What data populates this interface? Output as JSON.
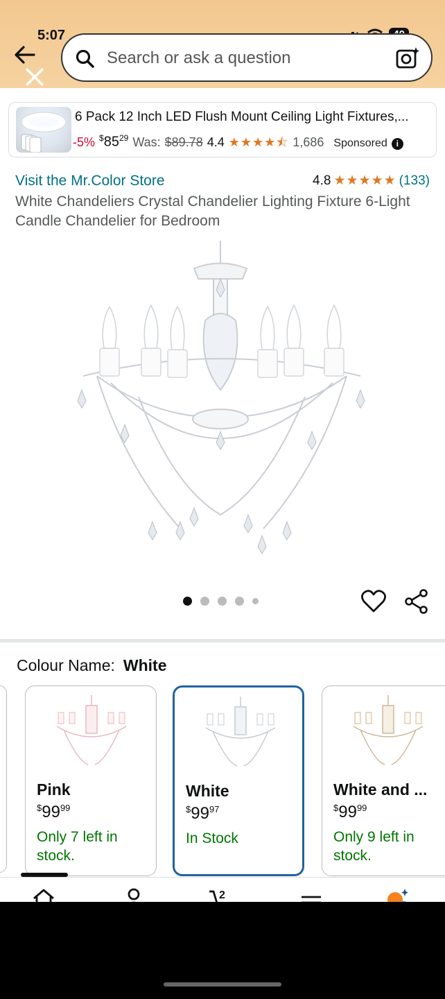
{
  "status": {
    "time": "5:07",
    "battery": "40"
  },
  "search": {
    "placeholder": "Search or ask a question"
  },
  "ad": {
    "title": "6 Pack 12 Inch LED Flush Mount Ceiling Light Fixtures,...",
    "discount": "-5%",
    "price_currency": "$",
    "price_whole": "85",
    "price_fraction": "29",
    "was_label": "Was:",
    "was_price": "$89.78",
    "rating": "4.4",
    "stars": "★★★★⯪",
    "review_count": "1,686",
    "sponsored": "Sponsored",
    "info": "i"
  },
  "product": {
    "store_link": "Visit the Mr.Color Store",
    "rating": "4.8",
    "stars": "★★★★★",
    "review_count": "(133)",
    "title": "White Chandeliers Crystal Chandelier Lighting Fixture 6-Light Candle Chandelier for Bedroom",
    "image_count": 5,
    "active_image": 1
  },
  "colour": {
    "label": "Colour Name:",
    "selected": "White",
    "options": [
      {
        "name": "Pink",
        "currency": "$",
        "whole": "99",
        "fraction": "99",
        "stock": "Only 7 left in stock."
      },
      {
        "name": "White",
        "currency": "$",
        "whole": "99",
        "fraction": "97",
        "stock": "In Stock"
      },
      {
        "name": "White and ...",
        "currency": "$",
        "whole": "99",
        "fraction": "99",
        "stock": "Only 9 left in stock."
      }
    ]
  },
  "bottom_nav": {
    "items": [
      "home-icon",
      "account-icon",
      "cart-icon",
      "menu-icon",
      "rufus-icon"
    ],
    "cart_count": "2"
  },
  "colors": {
    "header": "#f3c890",
    "link": "#007185",
    "stock": "#007600",
    "star": "#de7921",
    "selected_border": "#2162a1",
    "discount": "#cc0c39"
  }
}
